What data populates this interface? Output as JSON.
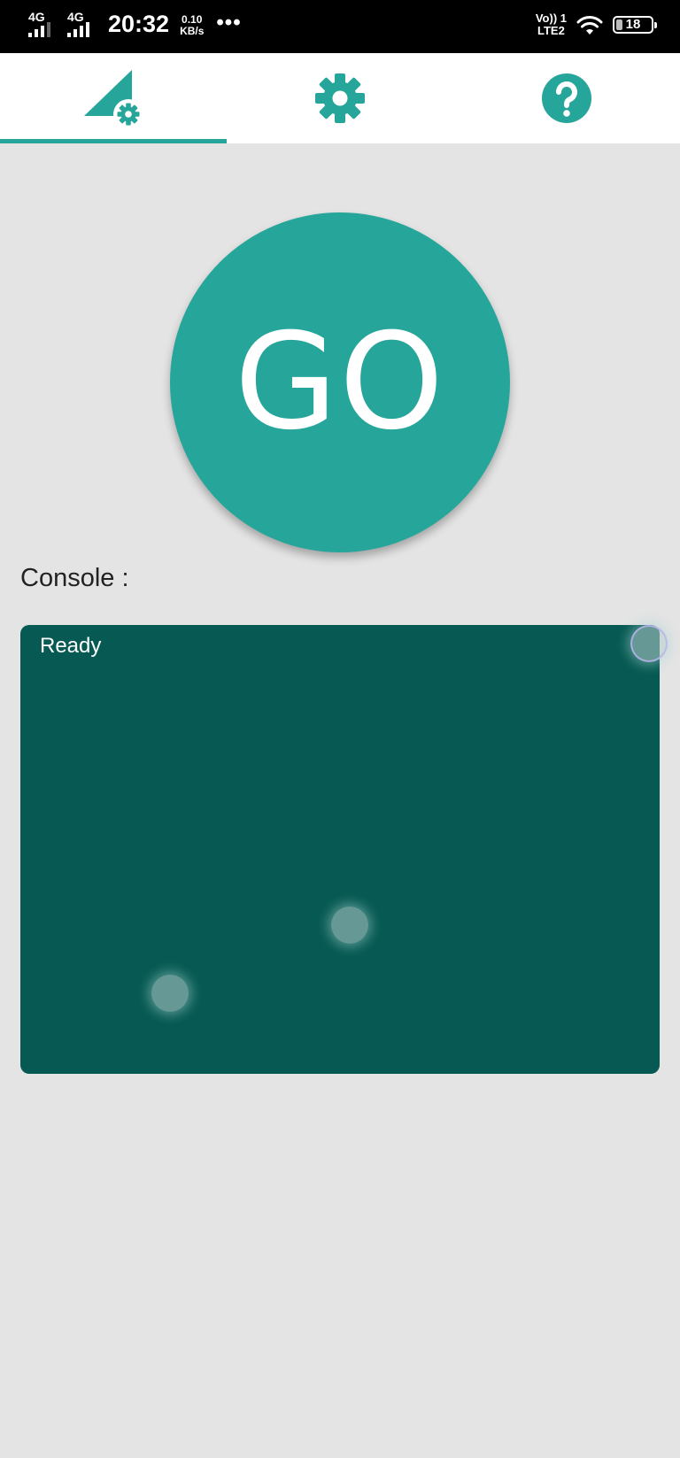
{
  "status_bar": {
    "network_1": "4G",
    "network_2": "4G",
    "time": "20:32",
    "speed_value": "0.10",
    "speed_unit": "KB/s",
    "more": "•••",
    "volte_top": "Vo)) 1",
    "volte_bottom": "LTE2",
    "battery_level": "18"
  },
  "tabs": [
    {
      "icon": "signal-settings-icon",
      "active": true
    },
    {
      "icon": "gear-icon",
      "active": false
    },
    {
      "icon": "help-icon",
      "active": false
    }
  ],
  "go_button": {
    "label": "GO"
  },
  "console": {
    "label": "Console :",
    "output": "Ready"
  },
  "colors": {
    "accent": "#26a69a",
    "console_background": "#075a53",
    "page_background": "#e4e4e4"
  }
}
